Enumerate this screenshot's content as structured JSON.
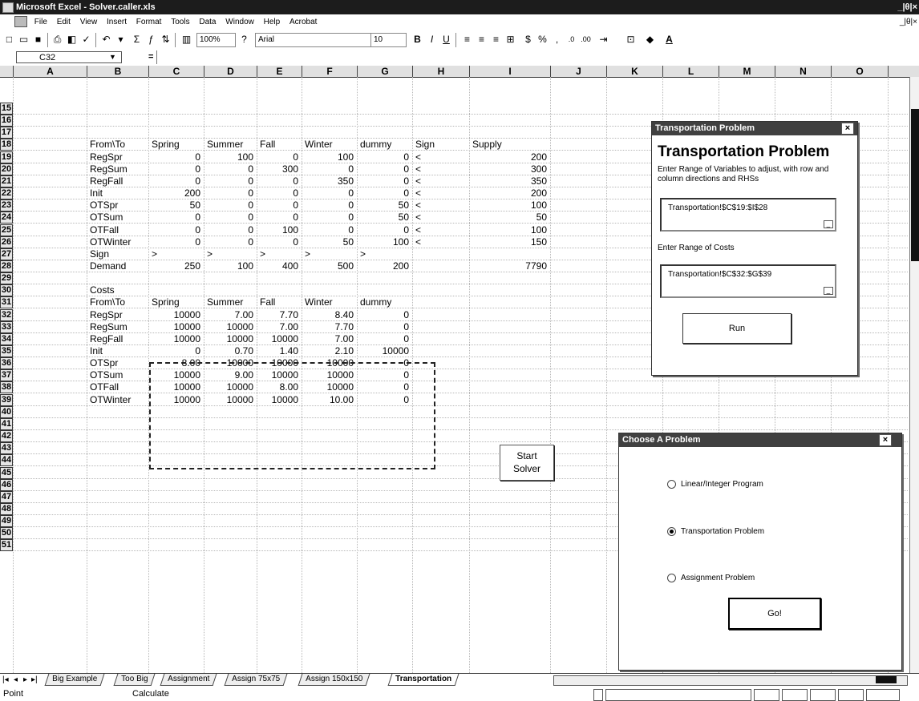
{
  "window": {
    "title": "Microsoft Excel - Solver.caller.xls",
    "controls": "_|θ|×"
  },
  "menu": [
    "File",
    "Edit",
    "View",
    "Insert",
    "Format",
    "Tools",
    "Data",
    "Window",
    "Help",
    "Acrobat"
  ],
  "menu_controls": "_|θ|×",
  "toolbar": {
    "zoom": "100%",
    "font": "Arial",
    "size": "10"
  },
  "namebox": {
    "cell": "C32",
    "eq": "="
  },
  "columns": [
    "A",
    "B",
    "C",
    "D",
    "E",
    "F",
    "G",
    "H",
    "I",
    "J",
    "K",
    "L",
    "M",
    "N",
    "O"
  ],
  "rows": [
    "15",
    "16",
    "17",
    "18",
    "19",
    "20",
    "21",
    "22",
    "23",
    "24",
    "25",
    "26",
    "27",
    "28",
    "29",
    "30",
    "31",
    "32",
    "33",
    "34",
    "35",
    "36",
    "37",
    "38",
    "39",
    "40",
    "41",
    "42",
    "43",
    "44",
    "45",
    "46",
    "47",
    "48",
    "49",
    "50",
    "51"
  ],
  "table1": {
    "headers": [
      "From\\To",
      "Spring",
      "Summer",
      "Fall",
      "Winter",
      "dummy",
      "Sign",
      "Supply"
    ],
    "rows": [
      [
        "RegSpr",
        "0",
        "100",
        "0",
        "100",
        "0",
        "<",
        "200"
      ],
      [
        "RegSum",
        "0",
        "0",
        "300",
        "0",
        "0",
        "<",
        "300"
      ],
      [
        "RegFall",
        "0",
        "0",
        "0",
        "350",
        "0",
        "<",
        "350"
      ],
      [
        "Init",
        "200",
        "0",
        "0",
        "0",
        "0",
        "<",
        "200"
      ],
      [
        "OTSpr",
        "50",
        "0",
        "0",
        "0",
        "50",
        "<",
        "100"
      ],
      [
        "OTSum",
        "0",
        "0",
        "0",
        "0",
        "50",
        "<",
        "50"
      ],
      [
        "OTFall",
        "0",
        "0",
        "100",
        "0",
        "0",
        "<",
        "100"
      ],
      [
        "OTWinter",
        "0",
        "0",
        "0",
        "50",
        "100",
        "<",
        "150"
      ]
    ],
    "sign_row": [
      "Sign",
      ">",
      ">",
      ">",
      ">",
      ">"
    ],
    "demand_row": [
      "Demand",
      "250",
      "100",
      "400",
      "500",
      "200",
      "7790"
    ]
  },
  "table2": {
    "title": "Costs",
    "headers": [
      "From\\To",
      "Spring",
      "Summer",
      "Fall",
      "Winter",
      "dummy"
    ],
    "rows": [
      [
        "RegSpr",
        "10000",
        "7.00",
        "7.70",
        "8.40",
        "0"
      ],
      [
        "RegSum",
        "10000",
        "10000",
        "7.00",
        "7.70",
        "0"
      ],
      [
        "RegFall",
        "10000",
        "10000",
        "10000",
        "7.00",
        "0"
      ],
      [
        "Init",
        "0",
        "0.70",
        "1.40",
        "2.10",
        "10000"
      ],
      [
        "OTSpr",
        "8.00",
        "10000",
        "10000",
        "10000",
        "0"
      ],
      [
        "OTSum",
        "10000",
        "9.00",
        "10000",
        "10000",
        "0"
      ],
      [
        "OTFall",
        "10000",
        "10000",
        "8.00",
        "10000",
        "0"
      ],
      [
        "OTWinter",
        "10000",
        "10000",
        "10000",
        "10.00",
        "0"
      ]
    ]
  },
  "start_button": {
    "line1": "Start",
    "line2": "Solver"
  },
  "transport_dialog": {
    "title": "Transportation Problem",
    "heading": "Transportation Problem",
    "instruction": "Enter Range of Variables to adjust, with row and column directions and RHSs",
    "range_vars": "Transportation!$C$19:$I$28",
    "costs_label": "Enter Range of Costs",
    "range_costs": "Transportation!$C$32:$G$39",
    "run": "Run",
    "close": "×"
  },
  "choose_dialog": {
    "title": "Choose A Problem",
    "options": [
      "Linear/Integer Program",
      "Transportation Problem",
      "Assignment Problem"
    ],
    "selected": 1,
    "go": "Go!",
    "close": "×"
  },
  "sheet_tabs": [
    "Big Example",
    "Too Big",
    "Assignment",
    "Assign 75x75",
    "Assign 150x150",
    "Transportation"
  ],
  "active_tab": "Transportation",
  "status": {
    "left": "Point",
    "mid": "Calculate"
  }
}
